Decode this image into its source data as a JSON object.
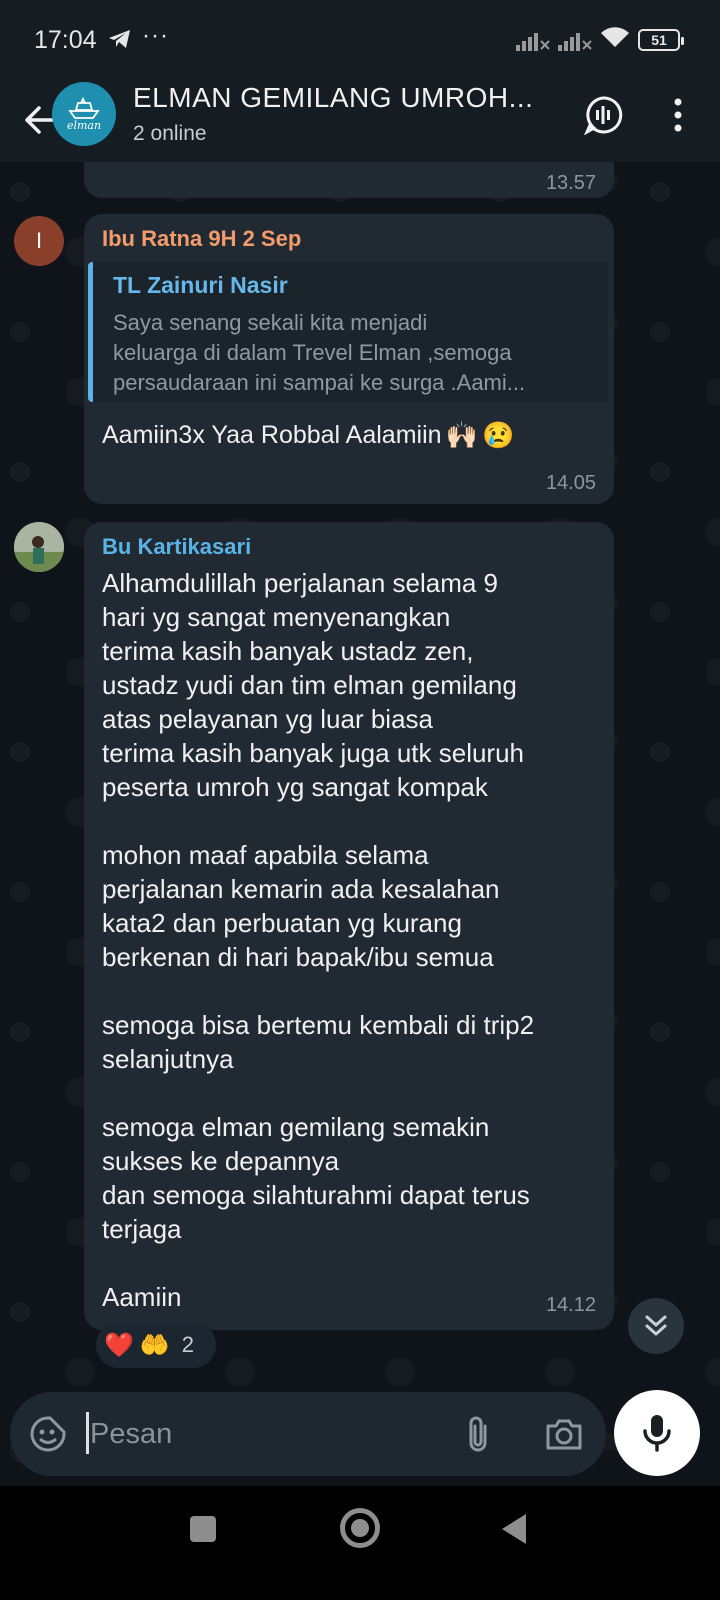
{
  "status_bar": {
    "time": "17:04",
    "dots": "···",
    "battery": "51"
  },
  "header": {
    "title": "ELMAN GEMILANG UMROH...",
    "subtitle": "2 online",
    "avatar_logo_text": "elman"
  },
  "chat": {
    "previous_message": {
      "time": "13.57"
    },
    "message_1": {
      "avatar_letter": "I",
      "sender": "Ibu Ratna 9H 2 Sep",
      "reply_to": {
        "name": "TL Zainuri Nasir",
        "lines": [
          "Saya senang sekali kita menjadi",
          "keluarga di dalam Trevel Elman ,semoga",
          "persaudaraan ini sampai ke surga .Aami..."
        ]
      },
      "text": "Aamiin3x Yaa Robbal Aalamiin",
      "emojis": [
        "🙌🏻",
        "😢"
      ],
      "time": "14.05"
    },
    "message_2": {
      "sender": "Bu Kartikasari",
      "paragraphs": [
        [
          "Alhamdulillah perjalanan selama 9",
          "hari yg sangat menyenangkan",
          "terima kasih banyak ustadz zen,",
          "ustadz yudi dan tim elman gemilang",
          "atas pelayanan yg luar biasa",
          "terima kasih banyak juga utk seluruh",
          "peserta umroh yg sangat kompak"
        ],
        [
          "mohon maaf apabila selama",
          "perjalanan kemarin ada kesalahan",
          "kata2 dan perbuatan yg kurang",
          "berkenan di hari bapak/ibu semua"
        ],
        [
          "semoga bisa bertemu kembali di trip2",
          "selanjutnya"
        ],
        [
          "semoga elman gemilang semakin",
          "sukses ke depannya",
          "dan semoga silahturahmi dapat terus",
          "terjaga"
        ],
        [
          "Aamiin"
        ]
      ],
      "time": "14.12",
      "reactions": {
        "items": [
          "❤️",
          "🤲"
        ],
        "count": "2"
      }
    }
  },
  "input": {
    "placeholder": "Pesan"
  },
  "colors": {
    "header_bg": "#151c22",
    "bubble_bg": "#212a33",
    "sender_ratna": "#f39b6b",
    "sender_kartika": "#5ab3e6"
  }
}
